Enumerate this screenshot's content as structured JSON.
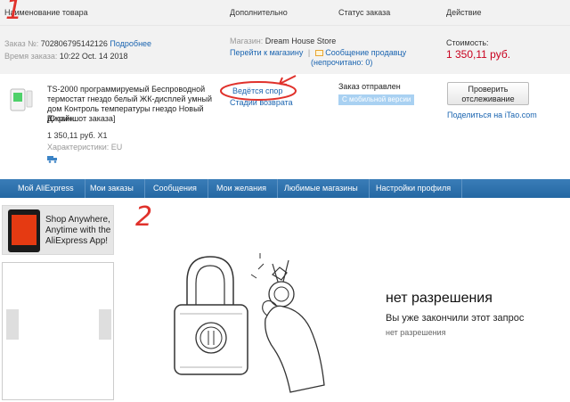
{
  "header": {
    "col_product": "Наименование товара",
    "col_details": "Дополнительно",
    "col_status": "Статус заказа",
    "col_action": "Действие"
  },
  "order": {
    "number_label": "Заказ №:",
    "number": "702806795142126",
    "details_link": "Подробнее",
    "time_label": "Время заказа:",
    "time": "10:22 Oct. 14 2018",
    "store_label": "Магазин:",
    "store_name": "Dream House Store",
    "store_link": "Перейти к магазину",
    "separator": "|",
    "message_link": "Сообщение продавцу",
    "unread": "(непрочитано: 0)",
    "cost_label": "Стоимость:",
    "cost": "1 350,11 руб."
  },
  "item": {
    "title": "TS-2000 программируемый Беспроводной термостат гнездо белый ЖК-дисплей умный дом Контроль температуры гнездо Новый Дизайн",
    "snapshot": "[Скриншот заказа]",
    "price": "1 350,11 руб. X1",
    "characteristics": "Характеристики: EU",
    "dispute_link": "Ведётся спор",
    "return_link": "Стадии возврата",
    "status": "Заказ отправлен",
    "mobile_badge": "С мобильной версии",
    "track_button": "Проверить отслеживание",
    "share_prefix": "Поделиться на ",
    "share_site": "iTao.com"
  },
  "nav": {
    "items": [
      "Мой AliExpress",
      "Мои заказы",
      "Сообщения",
      "Мои желания",
      "Любимые магазины",
      "Настройки профиля"
    ]
  },
  "promo": {
    "text": "Shop Anywhere, Anytime with the AliExpress App!"
  },
  "annotations": {
    "one": "1",
    "two": "2"
  },
  "no_permission": {
    "title": "нет разрешения",
    "subtitle": "Вы уже закончили этот запрос",
    "small": "нет разрешения"
  },
  "colors": {
    "accent_red": "#c8001e",
    "link_blue": "#1a64b0",
    "nav_blue": "#2d6fa9",
    "annotation_red": "#e0312b"
  }
}
